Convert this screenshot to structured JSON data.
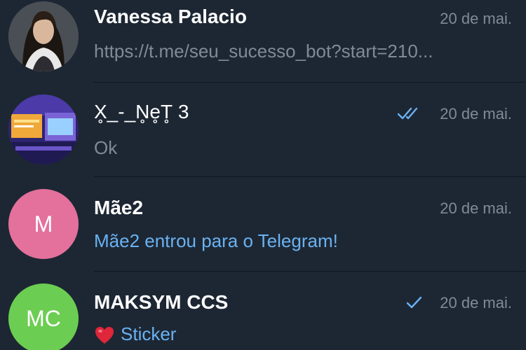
{
  "chats": [
    {
      "name": "Vanessa Palacio",
      "preview": "https://t.me/seu_sucesso_bot?start=210...",
      "date": "20 de mai.",
      "avatar_initials": "",
      "avatar_color": "#3a3f46"
    },
    {
      "name": "X̥_-_N̥e̥T̥ 3",
      "preview": "Ok",
      "date": "20 de mai.",
      "avatar_initials": "",
      "avatar_color": "#3b2f8a",
      "status": "read"
    },
    {
      "name": "Mãe2",
      "preview": "Mãe2 entrou para o Telegram!",
      "date": "20 de mai.",
      "avatar_initials": "M",
      "avatar_color": "#e4709c"
    },
    {
      "name": "MAKSYM CCS",
      "preview": "Sticker",
      "date": "20 de mai.",
      "avatar_initials": "MC",
      "avatar_color": "#6bcd52",
      "status": "sent"
    }
  ],
  "colors": {
    "background": "#1d2733",
    "accent": "#6ab2f2",
    "muted": "#7f8b97"
  }
}
